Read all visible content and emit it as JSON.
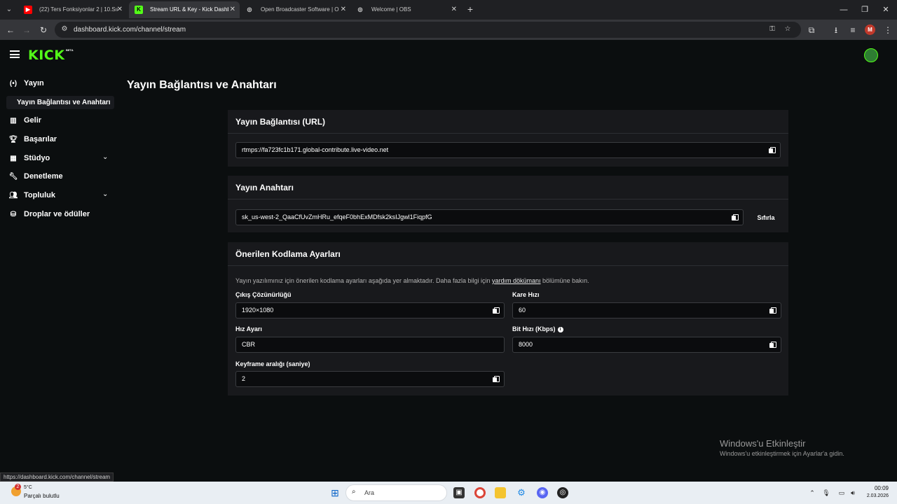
{
  "browser": {
    "tabs": [
      {
        "title": "(22) Ters Fonksiyonlar 2 | 10.Sınıf",
        "favicon": "youtube-icon",
        "active": false
      },
      {
        "title": "Stream URL & Key - Kick Dashboard",
        "favicon": "kick-icon",
        "active": true
      },
      {
        "title": "Open Broadcaster Software | OBS",
        "favicon": "obs-icon",
        "active": false
      },
      {
        "title": "Welcome | OBS",
        "favicon": "obs-icon",
        "active": false
      }
    ],
    "url": "dashboard.kick.com/channel/stream",
    "profile_initial": "M"
  },
  "app": {
    "logo": "KICK",
    "logo_badge": "BETA",
    "accent": "#53fc18"
  },
  "sidebar": {
    "items": [
      {
        "label": "Yayın",
        "icon": "broadcast-icon"
      },
      {
        "label": "Yayın Bağlantısı ve Anahtarı",
        "icon": ""
      },
      {
        "label": "Gelir",
        "icon": "chart-icon"
      },
      {
        "label": "Başarılar",
        "icon": "trophy-icon"
      },
      {
        "label": "Stüdyo",
        "icon": "grid-icon"
      },
      {
        "label": "Denetleme",
        "icon": "wrench-icon"
      },
      {
        "label": "Topluluk",
        "icon": "people-icon"
      },
      {
        "label": "Droplar ve ödüller",
        "icon": "gift-icon"
      }
    ]
  },
  "main": {
    "title": "Yayın Bağlantısı ve Anahtarı",
    "url_card": {
      "title": "Yayın Bağlantısı (URL)",
      "value": "rtmps://fa723fc1b171.global-contribute.live-video.net"
    },
    "key_card": {
      "title": "Yayın Anahtarı",
      "value": "sk_us-west-2_QaaCfUvZmHRu_efqeF0bhExMDfsk2ksIJgwl1FiqpfG",
      "reset_label": "Sıfırla"
    },
    "encoding_card": {
      "title": "Önerilen Kodlama Ayarları",
      "desc_before": "Yayın yazılımınız için önerilen kodlama ayarları aşağıda yer almaktadır. Daha fazla bilgi için ",
      "desc_link": "yardım dökümanı",
      "desc_after": " bölümüne bakın.",
      "fields": {
        "resolution": {
          "label": "Çıkış Çözünürlüğü",
          "value": "1920×1080"
        },
        "framerate": {
          "label": "Kare Hızı",
          "value": "60"
        },
        "rate_control": {
          "label": "Hız Ayarı",
          "value": "CBR"
        },
        "bitrate": {
          "label": "Bit Hızı (Kbps)",
          "value": "8000"
        },
        "keyframe": {
          "label": "Keyframe aralığı (saniye)",
          "value": "2"
        }
      }
    }
  },
  "overlay": {
    "activation_title": "Windows'u Etkinleştir",
    "activation_sub": "Windows'u etkinleştirmek için Ayarlar'a gidin.",
    "status_url": "https://dashboard.kick.com/channel/stream"
  },
  "taskbar": {
    "weather_temp": "5°C",
    "weather_desc": "Parçalı bulutlu",
    "weather_badge": "2",
    "search_placeholder": "Ara",
    "time": "00:09",
    "date": "2.03.2026"
  }
}
